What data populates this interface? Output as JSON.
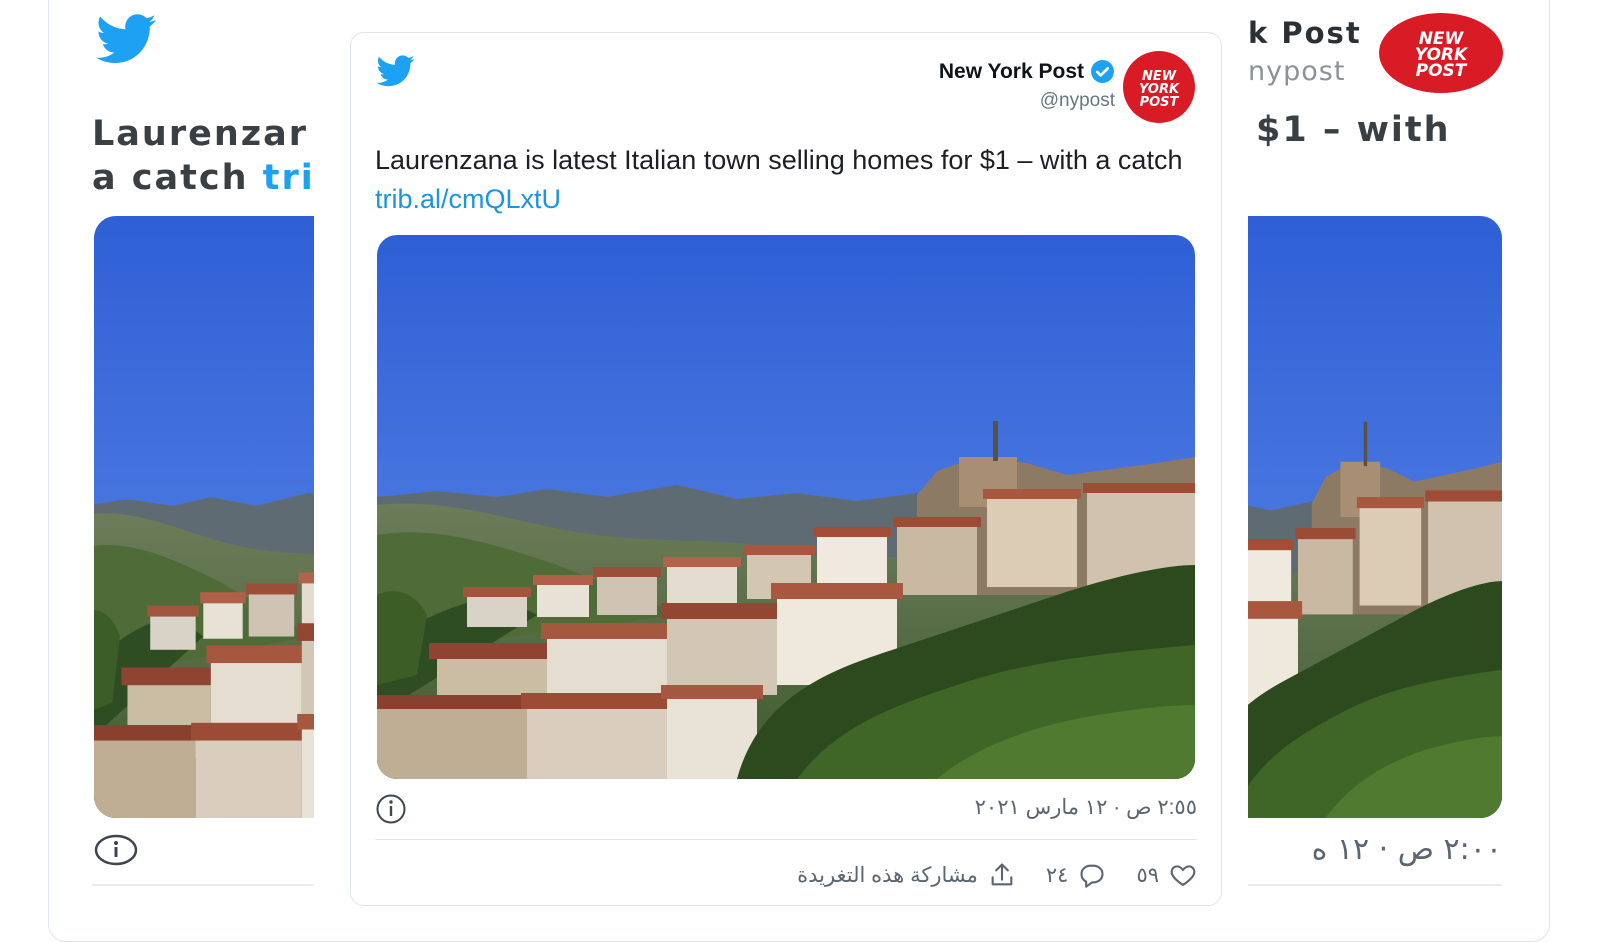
{
  "colors": {
    "twitter_blue": "#1da1f2",
    "link": "#1b95e0",
    "verified": "#1da1f2",
    "nyp_red": "#d91b26"
  },
  "background": {
    "left_text_line1": "Laurenzar",
    "left_text_line2_a": "a catch ",
    "left_text_line2_link": "tri",
    "right_name": "k Post",
    "right_handle": "nypost",
    "right_text": "$1 – with",
    "right_date": "٢:٠٠ ص · ١٢ ه"
  },
  "tweet": {
    "author_name": "New York Post",
    "author_handle": "@nypost",
    "avatar_logo": [
      "NEW",
      "YORK",
      "POST"
    ],
    "text": "Laurenzana is latest Italian town selling homes for $1 – with a catch ",
    "link": "trib.al/cmQLxtU",
    "timestamp": "٢:٥٥ ص · ١٢ مارس ٢٠٢١",
    "likes": "٥٩",
    "replies": "٢٤",
    "share_label": "مشاركة هذه التغريدة"
  },
  "icons": {
    "brand": "twitter-bird-icon",
    "verified": "verified-badge-icon",
    "info": "info-icon",
    "like": "heart-icon",
    "reply": "reply-bubble-icon",
    "share": "share-icon"
  }
}
